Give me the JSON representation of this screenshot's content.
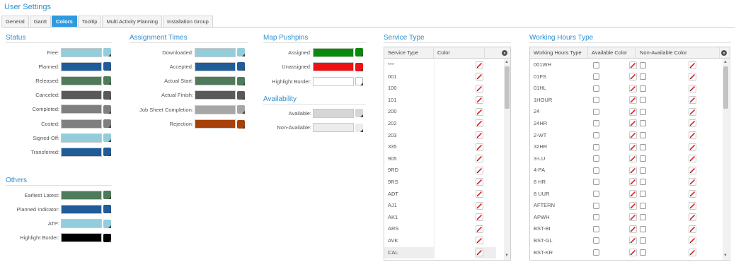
{
  "header": {
    "title": "User Settings"
  },
  "tabs": [
    {
      "label": "General",
      "active": false
    },
    {
      "label": "Gantt",
      "active": false
    },
    {
      "label": "Colors",
      "active": true
    },
    {
      "label": "Tooltip",
      "active": false
    },
    {
      "label": "Multi Activity Planning",
      "active": false
    },
    {
      "label": "Installation Group",
      "active": false
    }
  ],
  "status": {
    "title": "Status",
    "items": [
      {
        "label": "Free:",
        "color": "#92cddc"
      },
      {
        "label": "Planned:",
        "color": "#1f5c99"
      },
      {
        "label": "Released:",
        "color": "#4e7b5a"
      },
      {
        "label": "Canceled:",
        "color": "#595959"
      },
      {
        "label": "Completed:",
        "color": "#7f7f7f"
      },
      {
        "label": "Costed:",
        "color": "#7f7f7f"
      },
      {
        "label": "Signed-Off:",
        "color": "#92cddc"
      },
      {
        "label": "Transferred:",
        "color": "#1f5c99"
      }
    ]
  },
  "others": {
    "title": "Others",
    "items": [
      {
        "label": "Earliest Latest:",
        "color": "#4e7b5a"
      },
      {
        "label": "Planned Indicator:",
        "color": "#1f5c99"
      },
      {
        "label": "ATP:",
        "color": "#92cddc"
      },
      {
        "label": "Highlight Border:",
        "color": "#000000"
      }
    ]
  },
  "assignment": {
    "title": "Assignment Times",
    "items": [
      {
        "label": "Downloaded:",
        "color": "#92cddc"
      },
      {
        "label": "Accepted:",
        "color": "#1f5c99"
      },
      {
        "label": "Actual Start:",
        "color": "#4e7b5a"
      },
      {
        "label": "Actual Finish:",
        "color": "#595959"
      },
      {
        "label": "Job Sheet Completion:",
        "color": "#a6a6a6"
      },
      {
        "label": "Rejection:",
        "color": "#a6410a"
      }
    ]
  },
  "pushpins": {
    "title": "Map Pushpins",
    "items": [
      {
        "label": "Assigned:",
        "color": "#0a8a0a"
      },
      {
        "label": "Unassigned:",
        "color": "#ee1111"
      },
      {
        "label": "Highlight Border:",
        "color": "#ffffff"
      }
    ]
  },
  "availability": {
    "title": "Availability",
    "items": [
      {
        "label": "Available:",
        "color": "#d6d6d6"
      },
      {
        "label": "Non-Available:",
        "color": "#ececec"
      }
    ]
  },
  "service_type": {
    "title": "Service Type",
    "columns": [
      "Service Type",
      "Color"
    ],
    "rows": [
      "***",
      "001",
      "100",
      "101",
      "200",
      "202",
      "203",
      "335",
      "905",
      "9RD",
      "9RS",
      "ADT",
      "AJ1",
      "AK1",
      "ARS",
      "AVK",
      "CAL"
    ]
  },
  "working_hours": {
    "title": "Working Hours Type",
    "columns": [
      "Working Hours Type",
      "Available Color",
      "Non-Available Color"
    ],
    "rows": [
      "001WH",
      "01FS",
      "01HL",
      "1HOUR",
      "24",
      "24HR",
      "2-WT",
      "32HR",
      "3-LU",
      "4-PA",
      "8 HR",
      "8 UUR",
      "AFTERN",
      "APWH",
      "BST-BI",
      "BST-GL",
      "BST-KR"
    ]
  }
}
